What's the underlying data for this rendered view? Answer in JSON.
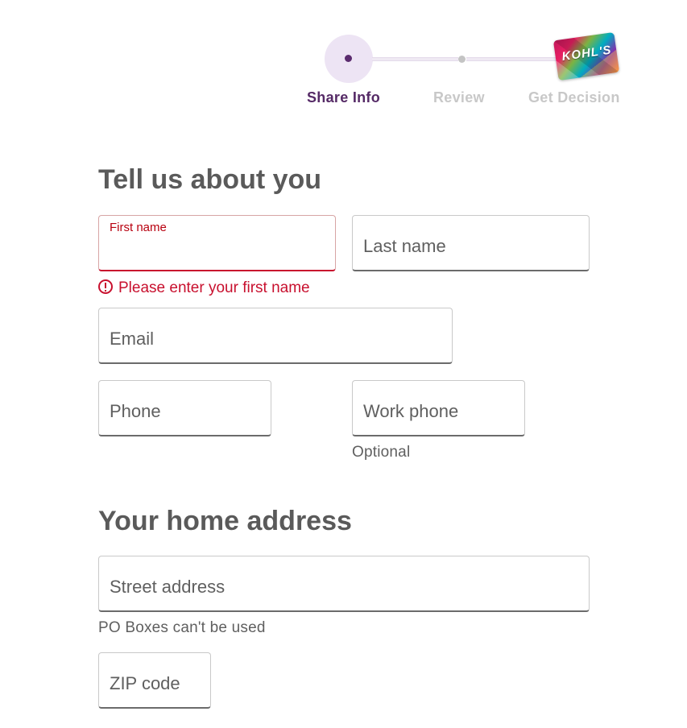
{
  "stepper": {
    "steps": [
      {
        "label": "Share Info",
        "state": "active"
      },
      {
        "label": "Review",
        "state": "inactive"
      },
      {
        "label": "Get Decision",
        "state": "inactive"
      }
    ],
    "card_logo": "KOHL'S",
    "colors": {
      "active": "#552a66",
      "inactive": "#c8c8c8",
      "halo": "#ede4f4"
    }
  },
  "about": {
    "heading": "Tell us about you",
    "first_name": {
      "label": "First name",
      "value": "",
      "error": "Please enter your first name"
    },
    "last_name": {
      "placeholder": "Last name",
      "value": ""
    },
    "email": {
      "placeholder": "Email",
      "value": ""
    },
    "phone": {
      "placeholder": "Phone",
      "value": ""
    },
    "work_phone": {
      "placeholder": "Work phone",
      "value": "",
      "helper": "Optional"
    }
  },
  "address": {
    "heading": "Your home address",
    "street": {
      "placeholder": "Street address",
      "value": "",
      "helper": "PO Boxes can't be used"
    },
    "zip": {
      "placeholder": "ZIP code",
      "value": ""
    }
  },
  "colors": {
    "error": "#c8102e",
    "text": "#5f5f5f",
    "heading": "#5a5a5a"
  }
}
